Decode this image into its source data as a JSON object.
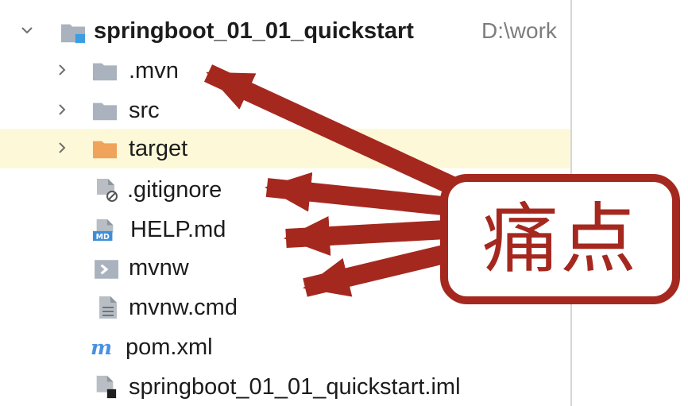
{
  "project_tree": {
    "root": {
      "name": "springboot_01_01_quickstart",
      "path": "D:\\work",
      "expanded": true
    },
    "items": [
      {
        "label": ".mvn",
        "type": "folder",
        "icon": "folder-icon"
      },
      {
        "label": "src",
        "type": "folder",
        "icon": "folder-icon"
      },
      {
        "label": "target",
        "type": "folder",
        "icon": "excluded-folder-icon",
        "selected": true
      },
      {
        "label": ".gitignore",
        "type": "file",
        "icon": "gitignore-file-icon"
      },
      {
        "label": "HELP.md",
        "type": "file",
        "icon": "markdown-file-icon"
      },
      {
        "label": "mvnw",
        "type": "file",
        "icon": "shell-script-icon"
      },
      {
        "label": "mvnw.cmd",
        "type": "file",
        "icon": "text-file-icon"
      },
      {
        "label": "pom.xml",
        "type": "file",
        "icon": "maven-icon"
      },
      {
        "label": "springboot_01_01_quickstart.iml",
        "type": "file",
        "icon": "iml-file-icon"
      }
    ]
  },
  "annotation": {
    "label": "痛点",
    "color": "#a5281f",
    "points_to": [
      ".mvn",
      ".gitignore",
      "HELP.md",
      "mvnw"
    ]
  },
  "colors": {
    "selected_row": "#fdf9d8",
    "folder": "#a9b2bd",
    "excluded_folder": "#f0a35b",
    "module_icon": "#3d9de3",
    "maven_icon": "#4a90e2"
  }
}
